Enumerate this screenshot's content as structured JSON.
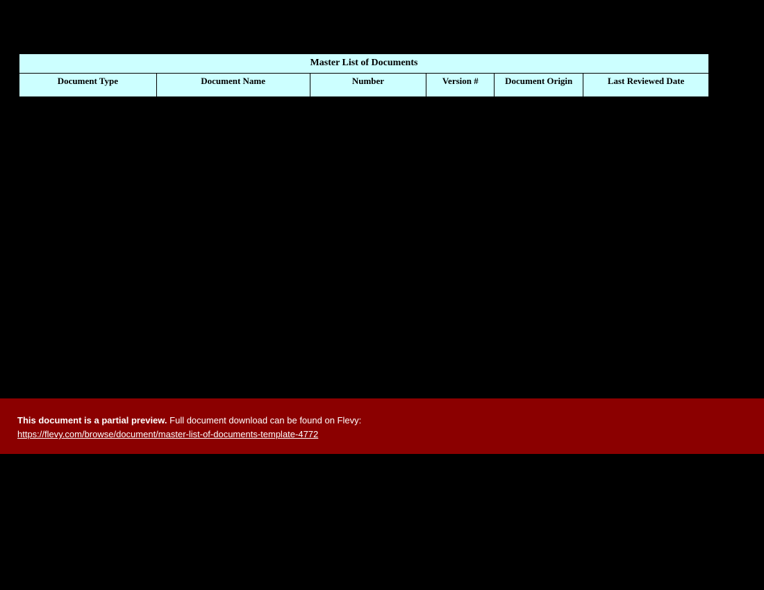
{
  "table": {
    "title": "Master List of Documents",
    "columns": [
      "Document Type",
      "Document Name",
      "Number",
      "Version #",
      "Document Origin",
      "Last Reviewed Date"
    ]
  },
  "banner": {
    "bold_text": "This document is a partial preview.",
    "rest_text": "  Full document download can be found on Flevy:",
    "link_text": "https://flevy.com/browse/document/master-list-of-documents-template-4772"
  }
}
